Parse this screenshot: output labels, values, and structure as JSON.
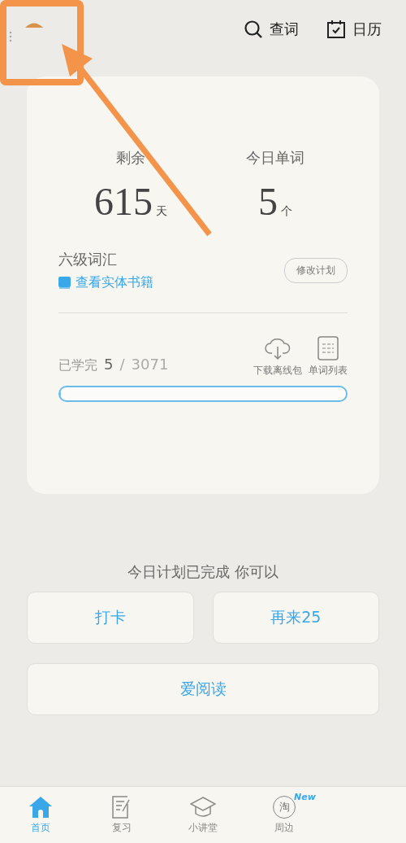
{
  "header": {
    "actions": [
      {
        "kind": "search",
        "label": "查词"
      },
      {
        "kind": "calendar",
        "label": "日历"
      }
    ]
  },
  "plan_card": {
    "stats": [
      {
        "label": "剩余",
        "value": "615",
        "unit": "天"
      },
      {
        "label": "今日单词",
        "value": "5",
        "unit": "个"
      }
    ],
    "book": {
      "title": "六级词汇",
      "link": "查看实体书籍",
      "edit_button": "修改计划"
    },
    "progress": {
      "label": "已学完",
      "learned": "5",
      "separator": "/",
      "total": "3071",
      "level": 0.002
    },
    "tools": [
      {
        "kind": "download",
        "label": "下载离线包"
      },
      {
        "kind": "list",
        "label": "单词列表"
      }
    ]
  },
  "done_message": "今日计划已完成 你可以",
  "options": [
    {
      "label": "打卡",
      "wide": false
    },
    {
      "label": "再来25",
      "wide": false
    },
    {
      "label": "爱阅读",
      "wide": true
    }
  ],
  "bottom_nav": [
    {
      "kind": "home",
      "label": "首页",
      "selected": true
    },
    {
      "kind": "review",
      "label": "复习",
      "selected": false
    },
    {
      "kind": "lecture",
      "label": "小讲堂",
      "selected": false
    },
    {
      "kind": "shop",
      "label": "周边",
      "selected": false,
      "icon_text": "淘",
      "badge": "New"
    }
  ]
}
